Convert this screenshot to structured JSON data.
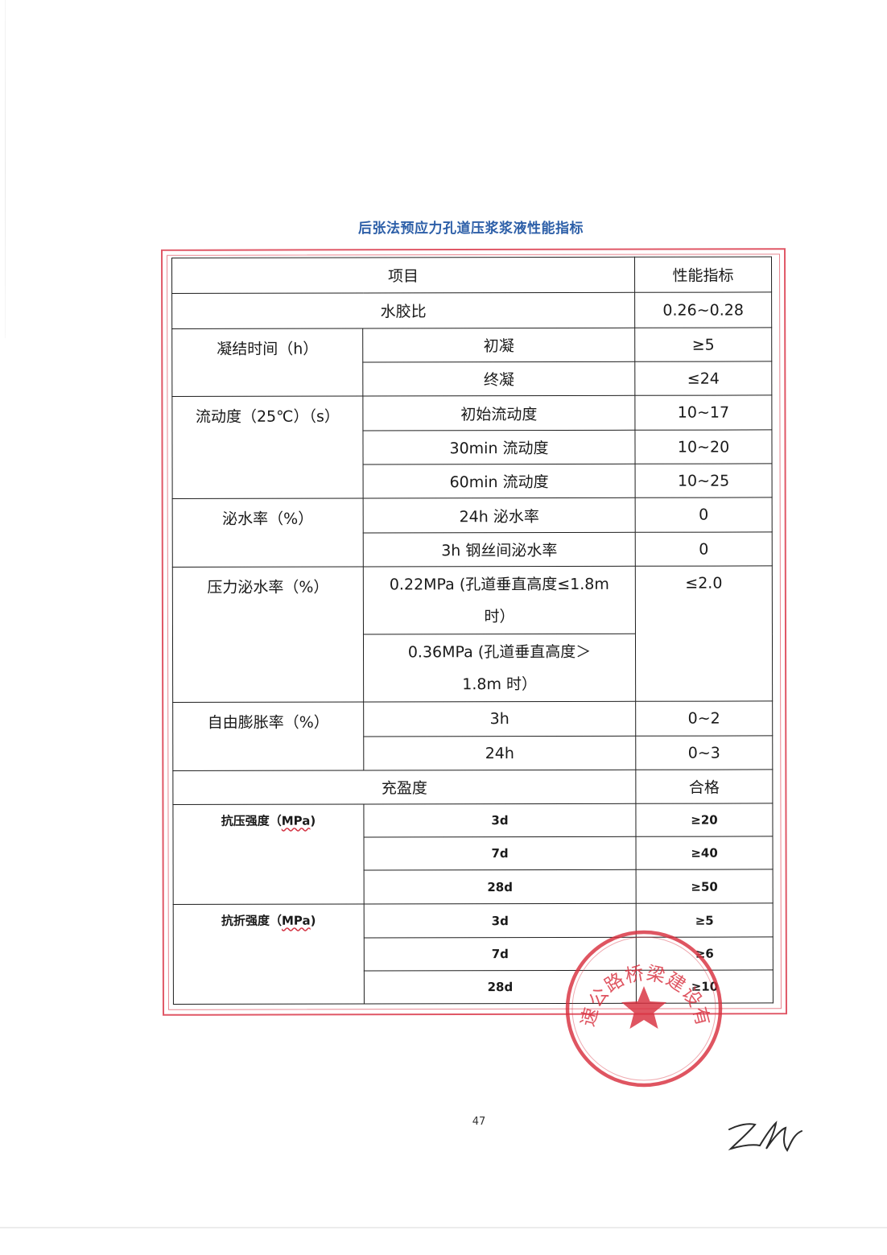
{
  "title": "后张法预应力孔道压浆浆液性能指标",
  "header": {
    "item": "项目",
    "indicator": "性能指标"
  },
  "rows": {
    "water_binder": {
      "label": "水胶比",
      "value": "0.26~0.28"
    },
    "setting": {
      "label": "凝结时间（h）",
      "items": [
        {
          "name": "初凝",
          "value": "≥5"
        },
        {
          "name": "终凝",
          "value": "≤24"
        }
      ]
    },
    "fluidity": {
      "label": "流动度（25℃）（s）",
      "items": [
        {
          "name": "初始流动度",
          "value": "10~17"
        },
        {
          "name": "30min 流动度",
          "value": "10~20"
        },
        {
          "name": "60min 流动度",
          "value": "10~25"
        }
      ]
    },
    "bleeding": {
      "label": "泌水率（%）",
      "items": [
        {
          "name": "24h 泌水率",
          "value": "0"
        },
        {
          "name": "3h 钢丝间泌水率",
          "value": "0"
        }
      ]
    },
    "pressure_bleeding": {
      "label": "压力泌水率（%）",
      "value": "≤2.0",
      "items": [
        {
          "name_line1": "0.22MPa (孔道垂直高度≤1.8m",
          "name_line2": "时）"
        },
        {
          "name_line1": "0.36MPa (孔道垂直高度＞",
          "name_line2": "1.8m 时）"
        }
      ]
    },
    "expansion": {
      "label": "自由膨胀率（%）",
      "items": [
        {
          "name": "3h",
          "value": "0~2"
        },
        {
          "name": "24h",
          "value": "0~3"
        }
      ]
    },
    "fullness": {
      "label": "充盈度",
      "value": "合格"
    },
    "compressive": {
      "label": "抗压强度",
      "unit": "MPa",
      "items": [
        {
          "name": "3d",
          "value": "≥20"
        },
        {
          "name": "7d",
          "value": "≥40"
        },
        {
          "name": "28d",
          "value": "≥50"
        }
      ]
    },
    "flexural": {
      "label": "抗折强度",
      "unit": "MPa",
      "items": [
        {
          "name": "3d",
          "value": "≥5"
        },
        {
          "name": "7d",
          "value": "≥6"
        },
        {
          "name": "28d",
          "value": "≥10"
        }
      ]
    }
  },
  "seal": {
    "text": "山东高速公路桥梁建设有限公司",
    "color": "#d9303f"
  },
  "page_number": "47",
  "colors": {
    "title": "#2d5fa8",
    "frame": "#e05766",
    "seal": "#d9303f"
  }
}
